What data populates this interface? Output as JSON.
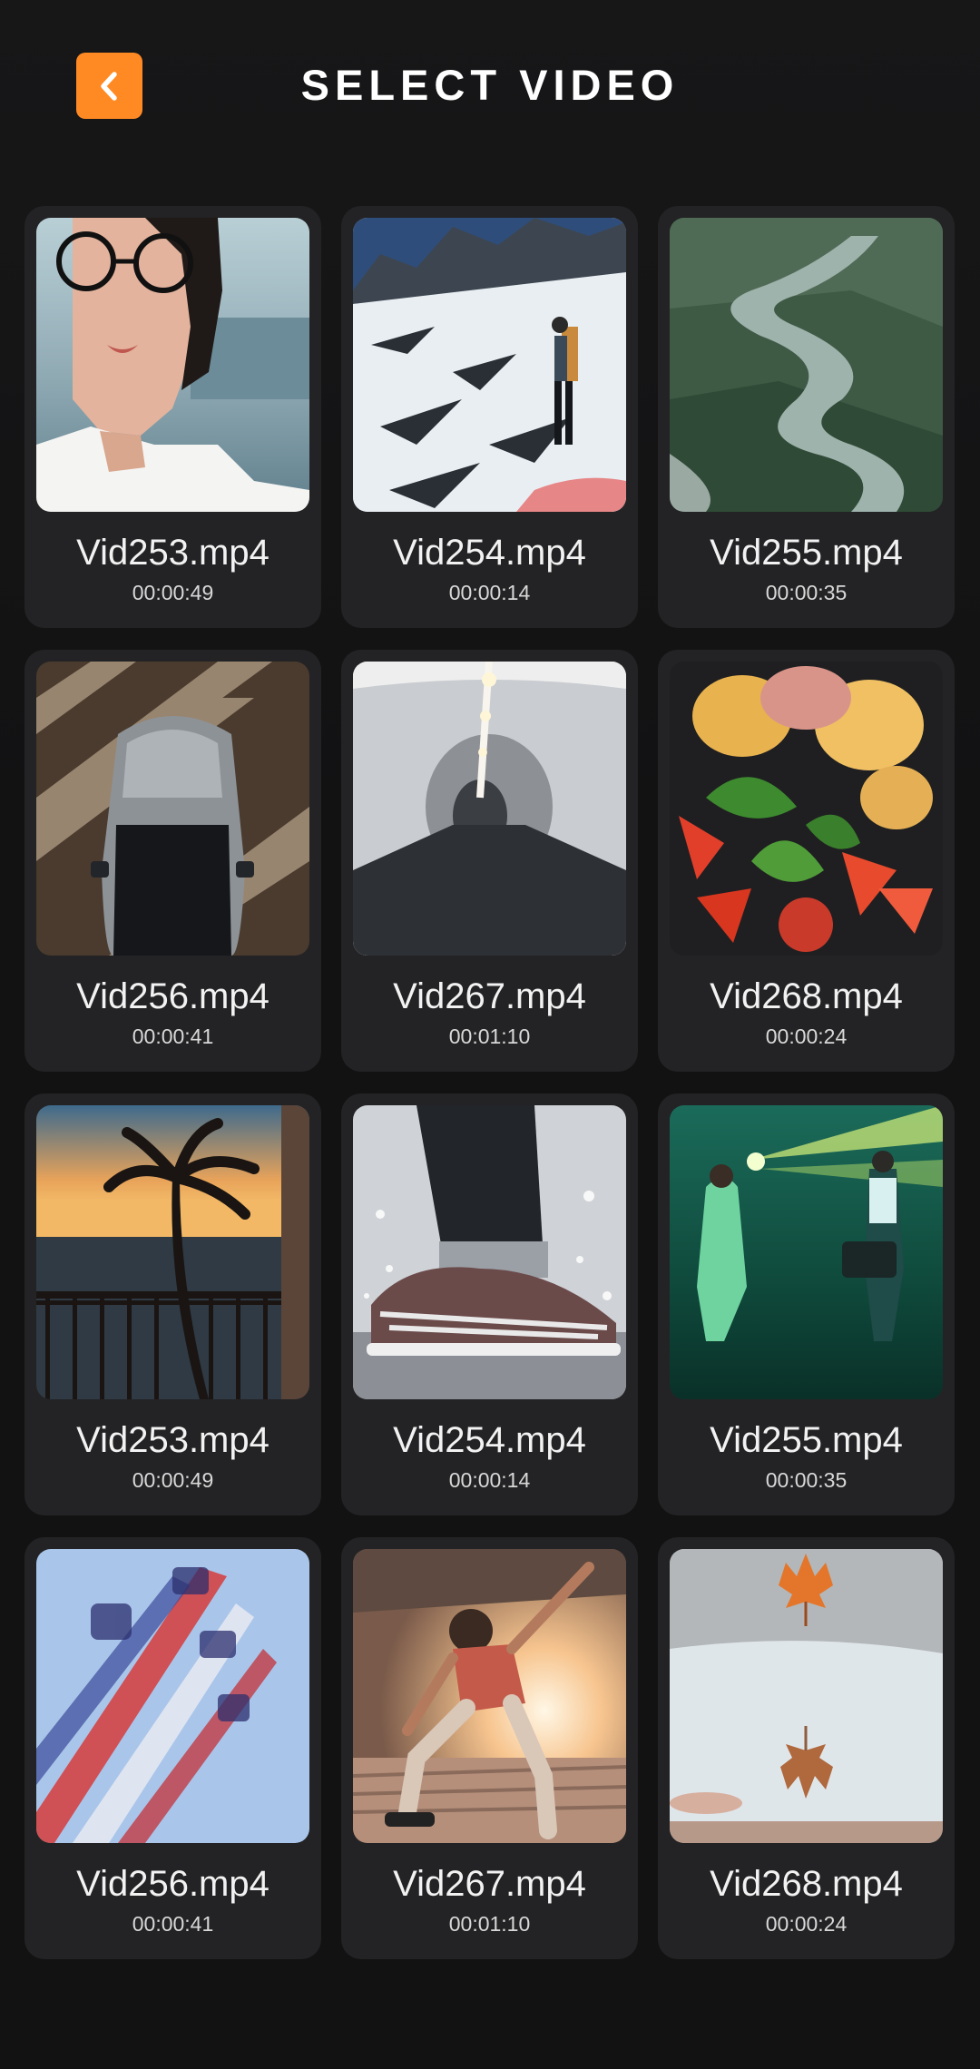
{
  "header": {
    "title": "SELECT VIDEO",
    "back_icon": "chevron-left-icon",
    "accent_color": "#ff8a24"
  },
  "videos": [
    {
      "name": "Vid253.mp4",
      "duration": "00:00:49",
      "thumbnail": "woman-with-glasses-portrait"
    },
    {
      "name": "Vid254.mp4",
      "duration": "00:00:14",
      "thumbnail": "hiker-on-snowy-mountain"
    },
    {
      "name": "Vid255.mp4",
      "duration": "00:00:35",
      "thumbnail": "aerial-river-valley"
    },
    {
      "name": "Vid256.mp4",
      "duration": "00:00:41",
      "thumbnail": "car-top-view-shadows"
    },
    {
      "name": "Vid267.mp4",
      "duration": "00:01:10",
      "thumbnail": "person-in-tunnel"
    },
    {
      "name": "Vid268.mp4",
      "duration": "00:00:24",
      "thumbnail": "salad-with-basil-tomato"
    },
    {
      "name": "Vid253.mp4",
      "duration": "00:00:49",
      "thumbnail": "palm-tree-sunset-balcony"
    },
    {
      "name": "Vid254.mp4",
      "duration": "00:00:14",
      "thumbnail": "sneaker-water-splash"
    },
    {
      "name": "Vid255.mp4",
      "duration": "00:00:35",
      "thumbnail": "concert-stage-green-lights"
    },
    {
      "name": "Vid256.mp4",
      "duration": "00:00:41",
      "thumbnail": "spinning-fair-ride"
    },
    {
      "name": "Vid267.mp4",
      "duration": "00:01:10",
      "thumbnail": "skateboarder-sunlight"
    },
    {
      "name": "Vid268.mp4",
      "duration": "00:00:24",
      "thumbnail": "maple-leaf-reflection"
    }
  ]
}
